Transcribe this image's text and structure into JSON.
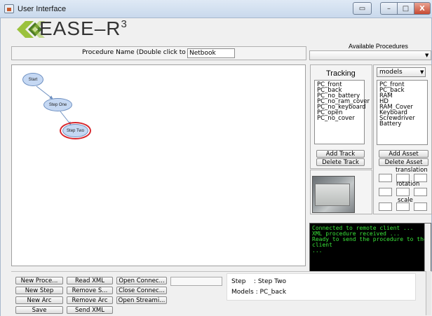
{
  "window": {
    "title": "User Interface",
    "restore": "▭",
    "minimize": "–",
    "maximize": "□",
    "close": "X"
  },
  "logo": {
    "text": "EASE–R",
    "superscript": "3",
    "colors": {
      "dark": "#4c7a25",
      "light": "#9bc23d"
    }
  },
  "procedure": {
    "label": "Procedure Name (Double click to rename)",
    "value": "Netbook"
  },
  "available_procedures": {
    "label": "Available Procedures",
    "selected": ""
  },
  "graph": {
    "nodes": [
      {
        "id": "start",
        "label": "Start",
        "selected": false
      },
      {
        "id": "step-one",
        "label": "Step One",
        "selected": false
      },
      {
        "id": "step-two",
        "label": "Step Two",
        "selected": true
      }
    ],
    "edges": [
      [
        "start",
        "step-one"
      ],
      [
        "step-one",
        "step-two"
      ]
    ],
    "selection_color": "#d7272d",
    "node_color": "#c5d8f3"
  },
  "tracking": {
    "title": "Tracking",
    "items": [
      "PC_front",
      "PC_back",
      "PC_no_battery",
      "PC_no_ram_cover",
      "PC_no_keyboard",
      "PC_open",
      "PC_no_cover"
    ],
    "add_label": "Add Track",
    "delete_label": "Delete Track"
  },
  "assets": {
    "filter": "models",
    "items": [
      "PC_front",
      "PC_back",
      "RAM",
      "HD",
      "RAM_Cover",
      "Keyboard",
      "Screwdriver",
      "Battery"
    ],
    "add_label": "Add Asset",
    "delete_label": "Delete Asset",
    "translation_label": "translation",
    "rotation_label": "rotation",
    "scale_label": "scale"
  },
  "console": {
    "lines": [
      "Connected to remote client ...",
      "XML procedure received ...",
      "Ready to send the procedure to the client",
      "..."
    ],
    "text_color": "#39e539"
  },
  "toolbar": {
    "new_procedure": "New Proce...",
    "read_xml": "Read XML",
    "open_connection": "Open Connec...",
    "new_step": "New Step",
    "remove_step": "Remove S...",
    "close_connection": "Close Connec...",
    "new_arc": "New Arc",
    "remove_arc": "Remove Arc",
    "open_streaming": "Open Streami...",
    "save": "Save",
    "send_xml": "Send XML"
  },
  "info": {
    "step_line": "Step    : Step Two",
    "models_line": "Models : PC_back"
  }
}
